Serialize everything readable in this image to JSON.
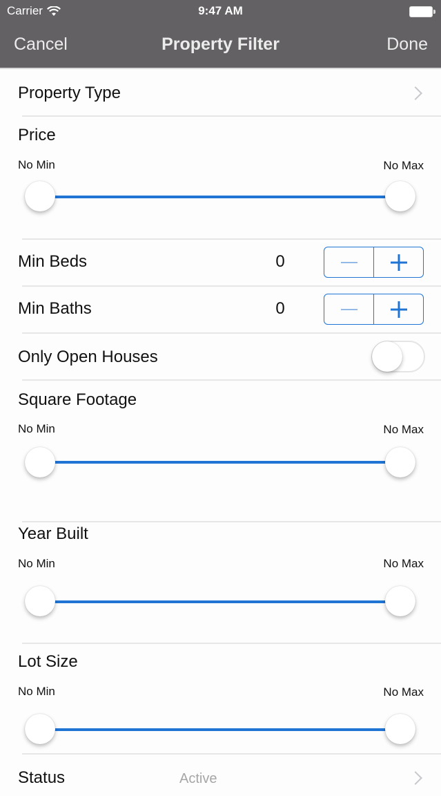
{
  "status_bar": {
    "carrier": "Carrier",
    "time": "9:47 AM",
    "wifi_icon": "wifi-icon",
    "battery_icon": "battery-icon"
  },
  "navbar": {
    "cancel_label": "Cancel",
    "title": "Property Filter",
    "done_label": "Done"
  },
  "colors": {
    "accent": "#1f74d4",
    "navbar_bg": "#636164",
    "secondary_text": "#a6a6a6"
  },
  "filters": {
    "property_type": {
      "label": "Property Type",
      "icon": "chevron-right-icon"
    },
    "price": {
      "label": "Price",
      "min_label": "No Min",
      "max_label": "No Max",
      "min_fraction": 0,
      "max_fraction": 1
    },
    "min_beds": {
      "label": "Min Beds",
      "value": "0",
      "minus_icon": "minus-icon",
      "plus_icon": "plus-icon"
    },
    "min_baths": {
      "label": "Min Baths",
      "value": "0",
      "minus_icon": "minus-icon",
      "plus_icon": "plus-icon"
    },
    "open_houses": {
      "label": "Only Open Houses",
      "enabled": false
    },
    "square_footage": {
      "label": "Square Footage",
      "min_label": "No Min",
      "max_label": "No Max",
      "min_fraction": 0,
      "max_fraction": 1
    },
    "year_built": {
      "label": "Year Built",
      "min_label": "No Min",
      "max_label": "No Max",
      "min_fraction": 0,
      "max_fraction": 1
    },
    "lot_size": {
      "label": "Lot Size",
      "min_label": "No Min",
      "max_label": "No Max",
      "min_fraction": 0,
      "max_fraction": 1
    },
    "status": {
      "label": "Status",
      "value": "Active",
      "icon": "chevron-right-icon"
    }
  }
}
